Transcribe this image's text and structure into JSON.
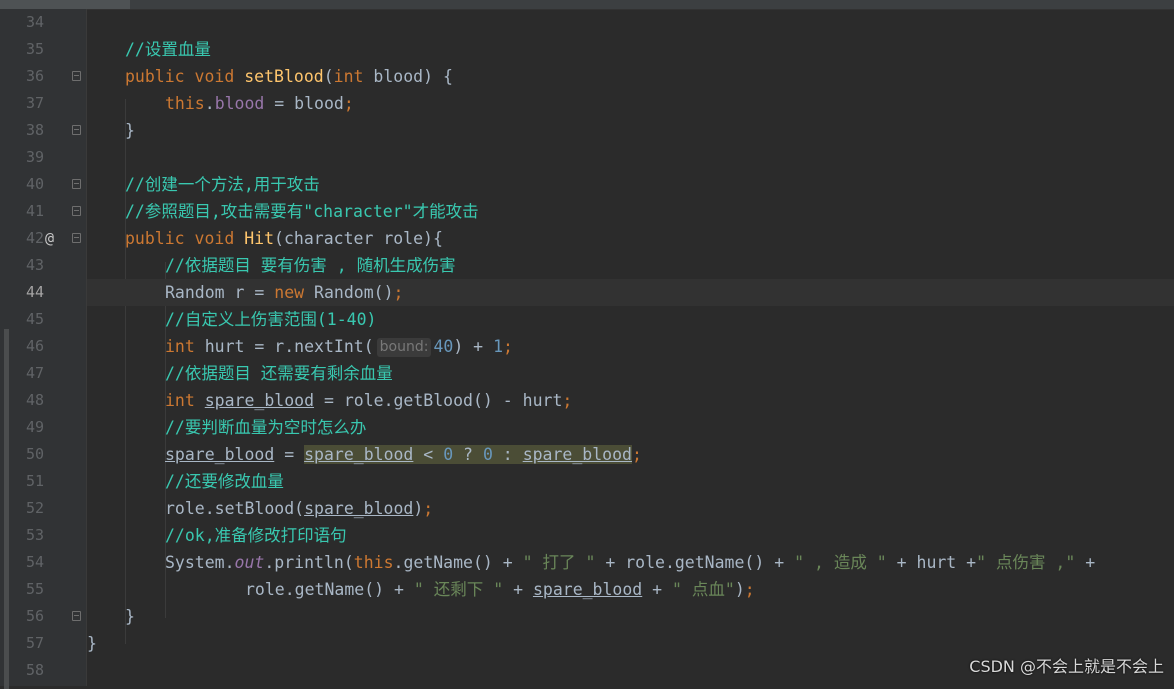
{
  "editor": {
    "language": "java",
    "current_line": "44",
    "lines": [
      {
        "num": "34"
      },
      {
        "num": "35",
        "c": "//设置血量"
      },
      {
        "num": "36",
        "a": "public",
        "b": " ",
        "c": "void",
        "d": " ",
        "e": "setBlood",
        "f": "(",
        "g": "int",
        "h": " blood) {"
      },
      {
        "num": "37",
        "a": "this",
        "b": ".",
        "c": "blood",
        "d": " = blood",
        "e": ";"
      },
      {
        "num": "38",
        "a": "}"
      },
      {
        "num": "39"
      },
      {
        "num": "40",
        "c": "//创建一个方法,用于攻击"
      },
      {
        "num": "41",
        "c": "//参照题目,攻击需要有\"character\"才能攻击"
      },
      {
        "num": "42",
        "icon": "@",
        "a": "public",
        "b": " ",
        "c": "void",
        "d": " ",
        "e": "Hit",
        "f": "(character role){"
      },
      {
        "num": "43",
        "c": "//依据题目 要有伤害 , 随机生成伤害"
      },
      {
        "num": "44",
        "a": "Random r = ",
        "b": "new",
        "c": " Random()",
        "d": ";"
      },
      {
        "num": "45",
        "c": "//自定义上伤害范围(1-40)"
      },
      {
        "num": "46",
        "a": "int",
        "b": " hurt = r.nextInt(",
        "hint": "bound:",
        "c": "40",
        "d": ") + ",
        "e": "1",
        "f": ";"
      },
      {
        "num": "47",
        "c": "//依据题目 还需要有剩余血量"
      },
      {
        "num": "48",
        "a": "int",
        "b": " ",
        "c": "spare_blood",
        "d": " = role.getBlood() - hurt",
        "e": ";"
      },
      {
        "num": "49",
        "c": "//要判断血量为空时怎么办"
      },
      {
        "num": "50",
        "a": "spare_blood",
        "b": " = ",
        "c": "spare_blood",
        "d": " < ",
        "e": "0",
        "f": " ? ",
        "g": "0",
        "h": " : ",
        "i": "spare_blood",
        "j": ";"
      },
      {
        "num": "51",
        "c": "//还要修改血量"
      },
      {
        "num": "52",
        "a": "role.setBlood(",
        "b": "spare_blood",
        "c": ")",
        "d": ";"
      },
      {
        "num": "53",
        "c": "//ok,准备修改打印语句"
      },
      {
        "num": "54",
        "a": "System.",
        "b": "out",
        "c": ".println(",
        "d": "this",
        "e": ".getName() + ",
        "f": "\" 打了 \"",
        "g": " + role.getName() + ",
        "h": "\" , 造成 \"",
        "i": " + hurt +",
        "j": "\" 点伤害 ,\"",
        "k": " +"
      },
      {
        "num": "55",
        "a": "role.getName() + ",
        "b": "\" 还剩下 \"",
        "c": " + ",
        "d": "spare_blood",
        "e": " + ",
        "f": "\" 点血\"",
        "g": ")",
        "h": ";"
      },
      {
        "num": "56",
        "a": "}"
      },
      {
        "num": "57",
        "a": "}"
      },
      {
        "num": "58"
      }
    ]
  },
  "watermark": "CSDN @不会上就是不会上"
}
